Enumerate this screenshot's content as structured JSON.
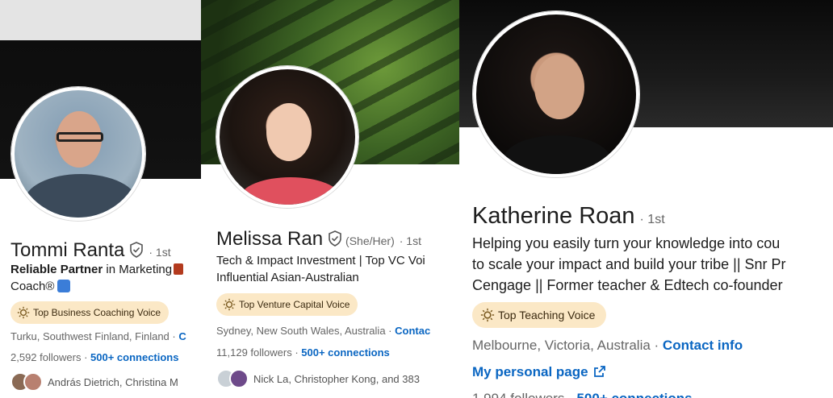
{
  "profiles": [
    {
      "name": "Tommi Ranta",
      "degree": "· 1st",
      "headline_bold": "Reliable Partner",
      "headline_rest": " in Marketing",
      "headline_line2": "Coach®",
      "voice_badge": "Top Business Coaching Voice",
      "location": "Turku, Southwest Finland, Finland",
      "contact_partial": "C",
      "followers": "2,592 followers",
      "connections": "500+ connections",
      "mutuals": "András Dietrich, Christina M"
    },
    {
      "name": "Melissa Ran",
      "pronouns": "(She/Her)",
      "degree": "· 1st",
      "headline_line1": "Tech & Impact Investment | Top VC Voi",
      "headline_line2": "Influential Asian-Australian",
      "voice_badge": "Top Venture Capital Voice",
      "location": "Sydney, New South Wales, Australia",
      "contact_partial": "Contac",
      "followers": "11,129 followers",
      "connections": "500+ connections",
      "mutuals": "Nick La, Christopher Kong, and 383"
    },
    {
      "name": "Katherine Roan",
      "degree": "· 1st",
      "headline_line1": "Helping you easily turn your knowledge into cou",
      "headline_line2": "to scale your impact and build your tribe || Snr Pr",
      "headline_line3": "Cengage || Former teacher & Edtech co-founder",
      "voice_badge": "Top Teaching Voice",
      "location": "Melbourne, Victoria, Australia",
      "contact": "Contact info",
      "personal_page": "My personal page",
      "followers_partial": "1,994 followers",
      "connections_partial": "500+ connections"
    }
  ],
  "colors": {
    "link": "#0a66c2",
    "badge_bg": "#fbe8c6",
    "text": "#1d1d1d",
    "muted": "#666666"
  },
  "icons": [
    "verified-shield-icon",
    "bulb-icon",
    "external-link-icon"
  ]
}
